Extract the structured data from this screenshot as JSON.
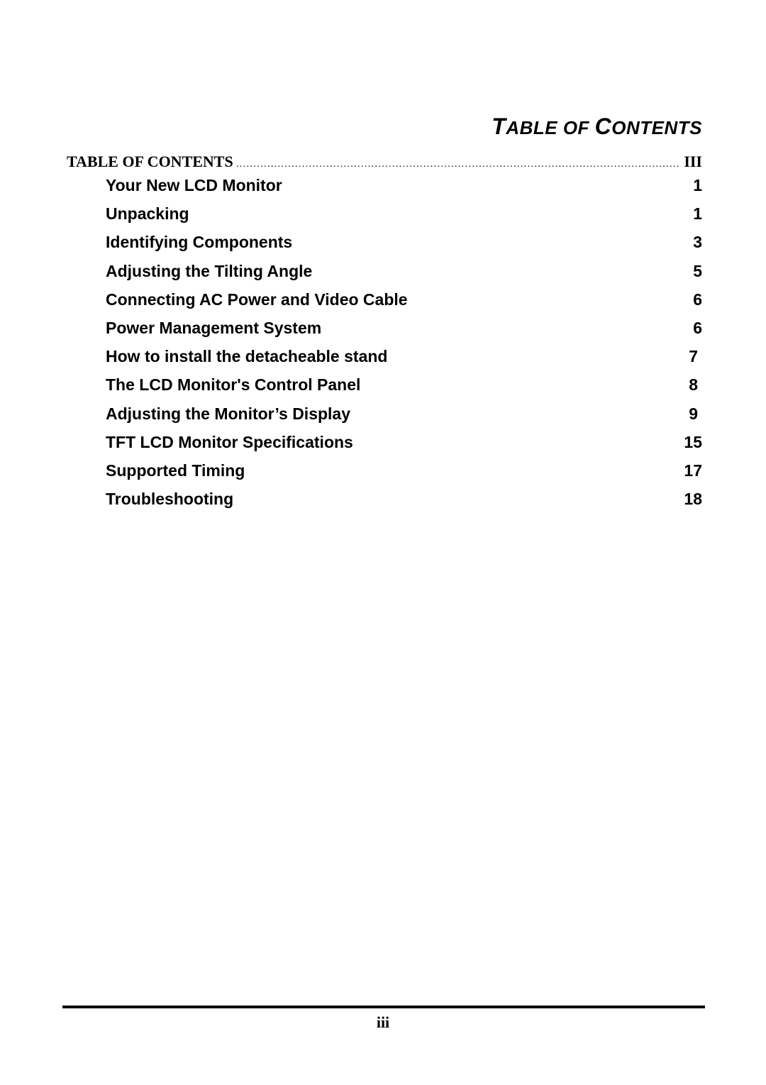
{
  "header": {
    "title_parts": [
      {
        "text": "T",
        "big": true
      },
      {
        "text": "ABLE OF ",
        "big": false
      },
      {
        "text": "C",
        "big": true
      },
      {
        "text": "ONTENTS",
        "big": false
      }
    ]
  },
  "toc_main": {
    "label": "TABLE OF CONTENTS",
    "dots": "............................................................................................................................................................",
    "page": "III"
  },
  "toc_entries": [
    {
      "title": "Your New LCD Monitor",
      "page": "1"
    },
    {
      "title": "Unpacking",
      "page": "1"
    },
    {
      "title": "Identifying Components",
      "page": "3"
    },
    {
      "title": "Adjusting the Tilting Angle",
      "page": "5"
    },
    {
      "title": "Connecting AC Power and Video Cable",
      "page": "6"
    },
    {
      "title": "Power Management System",
      "page": "6"
    },
    {
      "title": "How to install the detacheable stand",
      "page": "7"
    },
    {
      "title": "The LCD Monitor's Control Panel",
      "page": "8"
    },
    {
      "title": "Adjusting the Monitor’s Display",
      "page": "9"
    },
    {
      "title": "TFT LCD Monitor Specifications",
      "page": "15"
    },
    {
      "title": "Supported Timing",
      "page": "17"
    },
    {
      "title": "Troubleshooting",
      "page": "18"
    }
  ],
  "footer": {
    "page_number": "iii"
  }
}
